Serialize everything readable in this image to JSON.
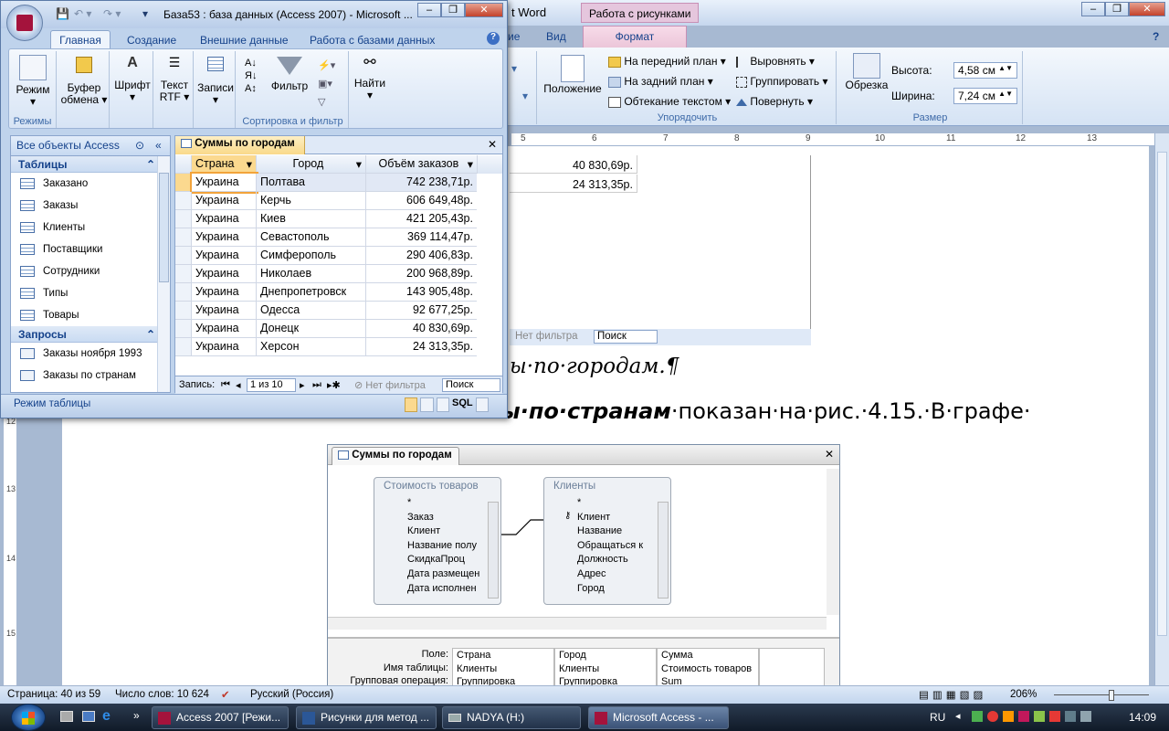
{
  "word": {
    "title_fragment": "t Word",
    "context_tab_group": "Работа с рисунками",
    "tabs": [
      "ие",
      "Вид"
    ],
    "context_tab": "Формат",
    "ribbon": {
      "position_label": "Положение",
      "bring_front": "На передний план",
      "send_back": "На задний план",
      "text_wrap": "Обтекание текстом",
      "align": "Выровнять",
      "group": "Группировать",
      "rotate": "Повернуть",
      "arrange_group": "Упорядочить",
      "crop": "Обрезка",
      "height_label": "Высота:",
      "height_value": "4,58 см",
      "width_label": "Ширина:",
      "width_value": "7,24 см",
      "size_group": "Размер"
    },
    "ruler": [
      "5",
      "6",
      "7",
      "8",
      "9",
      "10",
      "11",
      "12",
      "13"
    ],
    "vruler": [
      "12",
      "13",
      "14",
      "15"
    ],
    "doc": {
      "cells": [
        "40 830,69р.",
        "24 313,35р."
      ],
      "embedded_filter": "Нет фильтра",
      "embedded_search": "Поиск",
      "caption": "ы·по·городам.¶",
      "line_bold": "ы·по·странам",
      "line_rest": "·показан·на·рис.·4.15.·В·графе·"
    },
    "query": {
      "title": "Суммы по городам",
      "table1": {
        "name": "Стоимость товаров",
        "fields": [
          "*",
          "Заказ",
          "Клиент",
          "Название полу",
          "СкидкаПроц",
          "Дата размещен",
          "Дата исполнен"
        ]
      },
      "table2": {
        "name": "Клиенты",
        "fields": [
          "*",
          "Клиент",
          "Название",
          "Обращаться к",
          "Должность",
          "Адрес",
          "Город"
        ]
      },
      "grid_labels": [
        "Поле:",
        "Имя таблицы:",
        "Групповая операция:"
      ],
      "grid_cols": [
        [
          "Страна",
          "Клиенты",
          "Группировка"
        ],
        [
          "Город",
          "Клиенты",
          "Группировка"
        ],
        [
          "Сумма",
          "Стоимость товаров",
          "Sum"
        ]
      ]
    },
    "status": {
      "page": "Страница: 40 из 59",
      "words": "Число слов: 10 624",
      "lang": "Русский (Россия)",
      "zoom": "206%"
    }
  },
  "access": {
    "title": "База53 : база данных (Access 2007) - Microsoft ...",
    "tabs": [
      "Главная",
      "Создание",
      "Внешние данные",
      "Работа с базами данных"
    ],
    "ribbon": {
      "mode": "Режим",
      "clipboard": "Буфер обмена",
      "font": "Шрифт",
      "rtf": "Текст RTF",
      "records": "Записи",
      "filter": "Фильтр",
      "find": "Найти",
      "group_modes": "Режимы",
      "group_sort": "Сортировка и фильтр"
    },
    "nav": {
      "header": "Все объекты Access",
      "sections": [
        {
          "name": "Таблицы",
          "items": [
            "Заказано",
            "Заказы",
            "Клиенты",
            "Поставщики",
            "Сотрудники",
            "Типы",
            "Товары"
          ]
        },
        {
          "name": "Запросы",
          "items": [
            "Заказы ноября 1993",
            "Заказы по странам"
          ]
        }
      ]
    },
    "datasheet": {
      "tab": "Суммы по городам",
      "columns": [
        "Страна",
        "Город",
        "Объём заказов"
      ],
      "rows": [
        [
          "Украина",
          "Полтава",
          "742 238,71р."
        ],
        [
          "Украина",
          "Керчь",
          "606 649,48р."
        ],
        [
          "Украина",
          "Киев",
          "421 205,43р."
        ],
        [
          "Украина",
          "Севастополь",
          "369 114,47р."
        ],
        [
          "Украина",
          "Симферополь",
          "290 406,83р."
        ],
        [
          "Украина",
          "Николаев",
          "200 968,89р."
        ],
        [
          "Украина",
          "Днепропетровск",
          "143 905,48р."
        ],
        [
          "Украина",
          "Одесса",
          "92 677,25р."
        ],
        [
          "Украина",
          "Донецк",
          "40 830,69р."
        ],
        [
          "Украина",
          "Херсон",
          "24 313,35р."
        ]
      ],
      "record_label": "Запись:",
      "record_pos": "1 из 10",
      "filter": "Нет фильтра",
      "search": "Поиск"
    },
    "status": "Режим таблицы",
    "view_sql": "SQL"
  },
  "taskbar": {
    "items": [
      "Access 2007 [Режи...",
      "Рисунки для метод ...",
      "NADYA (H:)",
      "Microsoft Access - ..."
    ],
    "lang": "RU",
    "time": "14:09"
  }
}
